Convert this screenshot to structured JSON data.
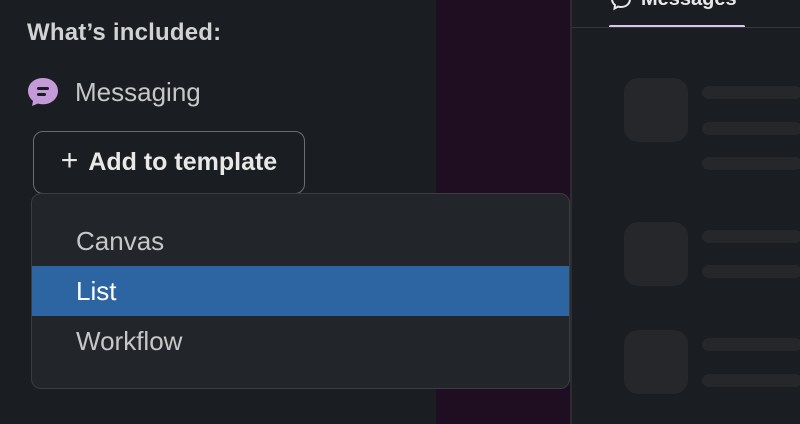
{
  "left": {
    "section_title": "What’s included:",
    "included_items": [
      {
        "label": "Messaging",
        "icon": "message-bubble-icon",
        "icon_color": "#c59ad9"
      }
    ],
    "add_button_label": "Add to template"
  },
  "dropdown": {
    "options": [
      {
        "label": "Canvas",
        "selected": false
      },
      {
        "label": "List",
        "selected": true
      },
      {
        "label": "Workflow",
        "selected": false
      }
    ],
    "selected_color": "#2d64a2"
  },
  "right": {
    "tab_label": "Messages",
    "tab_icon": "message-bubble-icon",
    "accent": "#dcc4f0"
  },
  "colors": {
    "background": "#1a1d21",
    "sidebar_purple": "#1f0d22",
    "dropdown_bg": "#222529"
  }
}
